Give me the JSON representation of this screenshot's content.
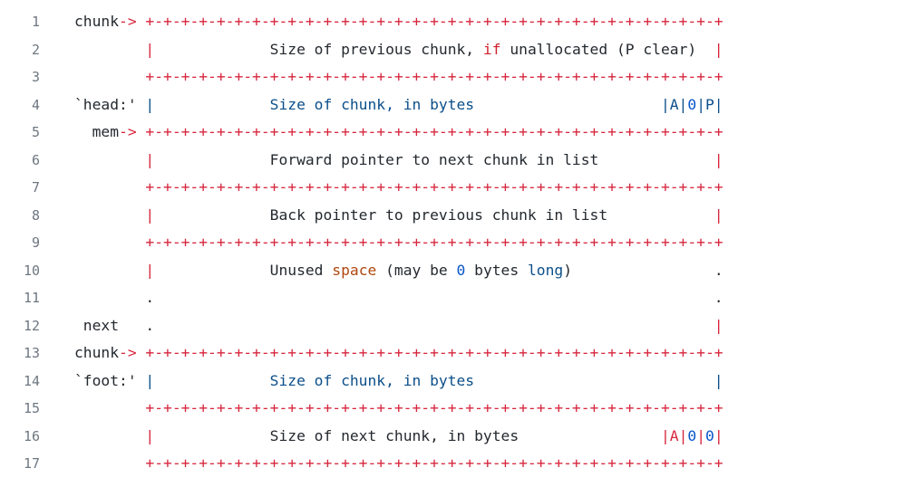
{
  "colors": {
    "background": "#ffffff",
    "line_number": "#6e7781",
    "plain": "#24292f",
    "operator": "#d7263d",
    "keyword": "#cf222e",
    "identifier": "#0b4f8a",
    "number": "#0a58ca",
    "builtin": "#b1470e"
  },
  "lines": [
    {
      "n": "1",
      "tokens": [
        {
          "t": "chunk",
          "c": "plain"
        },
        {
          "t": "->",
          "c": "op"
        },
        {
          "t": " +-+-+-+-+-+-+-+-+-+-+-+-+-+-+-+-+-+-+-+-+-+-+-+-+-+-+-+-+-+-+-+-+",
          "c": "op"
        }
      ]
    },
    {
      "n": "2",
      "tokens": [
        {
          "t": "        ",
          "c": "plain"
        },
        {
          "t": "|",
          "c": "op"
        },
        {
          "t": "             Size of previous chunk, ",
          "c": "plain"
        },
        {
          "t": "if",
          "c": "kw"
        },
        {
          "t": " unallocated (P clear)  ",
          "c": "plain"
        },
        {
          "t": "|",
          "c": "op"
        }
      ]
    },
    {
      "n": "3",
      "tokens": [
        {
          "t": "        ",
          "c": "plain"
        },
        {
          "t": "+-+-+-+-+-+-+-+-+-+-+-+-+-+-+-+-+-+-+-+-+-+-+-+-+-+-+-+-+-+-+-+-+",
          "c": "op"
        }
      ]
    },
    {
      "n": "4",
      "tokens": [
        {
          "t": "`head:' ",
          "c": "plain"
        },
        {
          "t": "|",
          "c": "blue"
        },
        {
          "t": "             Size of chunk, in bytes                     |A|",
          "c": "blue"
        },
        {
          "t": "0",
          "c": "num"
        },
        {
          "t": "|P|",
          "c": "blue"
        }
      ]
    },
    {
      "n": "5",
      "tokens": [
        {
          "t": "  mem",
          "c": "plain"
        },
        {
          "t": "->",
          "c": "op"
        },
        {
          "t": " +-+-+-+-+-+-+-+-+-+-+-+-+-+-+-+-+-+-+-+-+-+-+-+-+-+-+-+-+-+-+-+-+",
          "c": "op"
        }
      ]
    },
    {
      "n": "6",
      "tokens": [
        {
          "t": "        ",
          "c": "plain"
        },
        {
          "t": "|",
          "c": "op"
        },
        {
          "t": "             Forward pointer to next chunk in list             ",
          "c": "plain"
        },
        {
          "t": "|",
          "c": "op"
        }
      ]
    },
    {
      "n": "7",
      "tokens": [
        {
          "t": "        ",
          "c": "plain"
        },
        {
          "t": "+-+-+-+-+-+-+-+-+-+-+-+-+-+-+-+-+-+-+-+-+-+-+-+-+-+-+-+-+-+-+-+-+",
          "c": "op"
        }
      ]
    },
    {
      "n": "8",
      "tokens": [
        {
          "t": "        ",
          "c": "plain"
        },
        {
          "t": "|",
          "c": "op"
        },
        {
          "t": "             Back pointer to previous chunk in list            ",
          "c": "plain"
        },
        {
          "t": "|",
          "c": "op"
        }
      ]
    },
    {
      "n": "9",
      "tokens": [
        {
          "t": "        ",
          "c": "plain"
        },
        {
          "t": "+-+-+-+-+-+-+-+-+-+-+-+-+-+-+-+-+-+-+-+-+-+-+-+-+-+-+-+-+-+-+-+-+",
          "c": "op"
        }
      ]
    },
    {
      "n": "10",
      "tokens": [
        {
          "t": "        ",
          "c": "plain"
        },
        {
          "t": "|",
          "c": "op"
        },
        {
          "t": "             Unused ",
          "c": "plain"
        },
        {
          "t": "space",
          "c": "orange"
        },
        {
          "t": " (may be ",
          "c": "plain"
        },
        {
          "t": "0",
          "c": "num"
        },
        {
          "t": " bytes ",
          "c": "plain"
        },
        {
          "t": "long",
          "c": "blue"
        },
        {
          "t": ")                .",
          "c": "plain"
        }
      ]
    },
    {
      "n": "11",
      "tokens": [
        {
          "t": "        .                                                               .",
          "c": "plain"
        }
      ]
    },
    {
      "n": "12",
      "tokens": [
        {
          "t": " next   .                                                               ",
          "c": "plain"
        },
        {
          "t": "|",
          "c": "op"
        }
      ]
    },
    {
      "n": "13",
      "tokens": [
        {
          "t": "chunk",
          "c": "plain"
        },
        {
          "t": "->",
          "c": "op"
        },
        {
          "t": " +-+-+-+-+-+-+-+-+-+-+-+-+-+-+-+-+-+-+-+-+-+-+-+-+-+-+-+-+-+-+-+-+",
          "c": "op"
        }
      ]
    },
    {
      "n": "14",
      "tokens": [
        {
          "t": "`foot:' ",
          "c": "plain"
        },
        {
          "t": "|",
          "c": "blue"
        },
        {
          "t": "             Size of chunk, in bytes                           |",
          "c": "blue"
        }
      ]
    },
    {
      "n": "15",
      "tokens": [
        {
          "t": "        ",
          "c": "plain"
        },
        {
          "t": "+-+-+-+-+-+-+-+-+-+-+-+-+-+-+-+-+-+-+-+-+-+-+-+-+-+-+-+-+-+-+-+-+",
          "c": "op"
        }
      ]
    },
    {
      "n": "16",
      "tokens": [
        {
          "t": "        ",
          "c": "plain"
        },
        {
          "t": "|",
          "c": "op"
        },
        {
          "t": "             Size of next chunk, in bytes                ",
          "c": "plain"
        },
        {
          "t": "|A|",
          "c": "op"
        },
        {
          "t": "0",
          "c": "num"
        },
        {
          "t": "|",
          "c": "op"
        },
        {
          "t": "0",
          "c": "num"
        },
        {
          "t": "|",
          "c": "op"
        }
      ]
    },
    {
      "n": "17",
      "tokens": [
        {
          "t": "        ",
          "c": "plain"
        },
        {
          "t": "+-+-+-+-+-+-+-+-+-+-+-+-+-+-+-+-+-+-+-+-+-+-+-+-+-+-+-+-+-+-+-+-+",
          "c": "op"
        }
      ]
    }
  ]
}
